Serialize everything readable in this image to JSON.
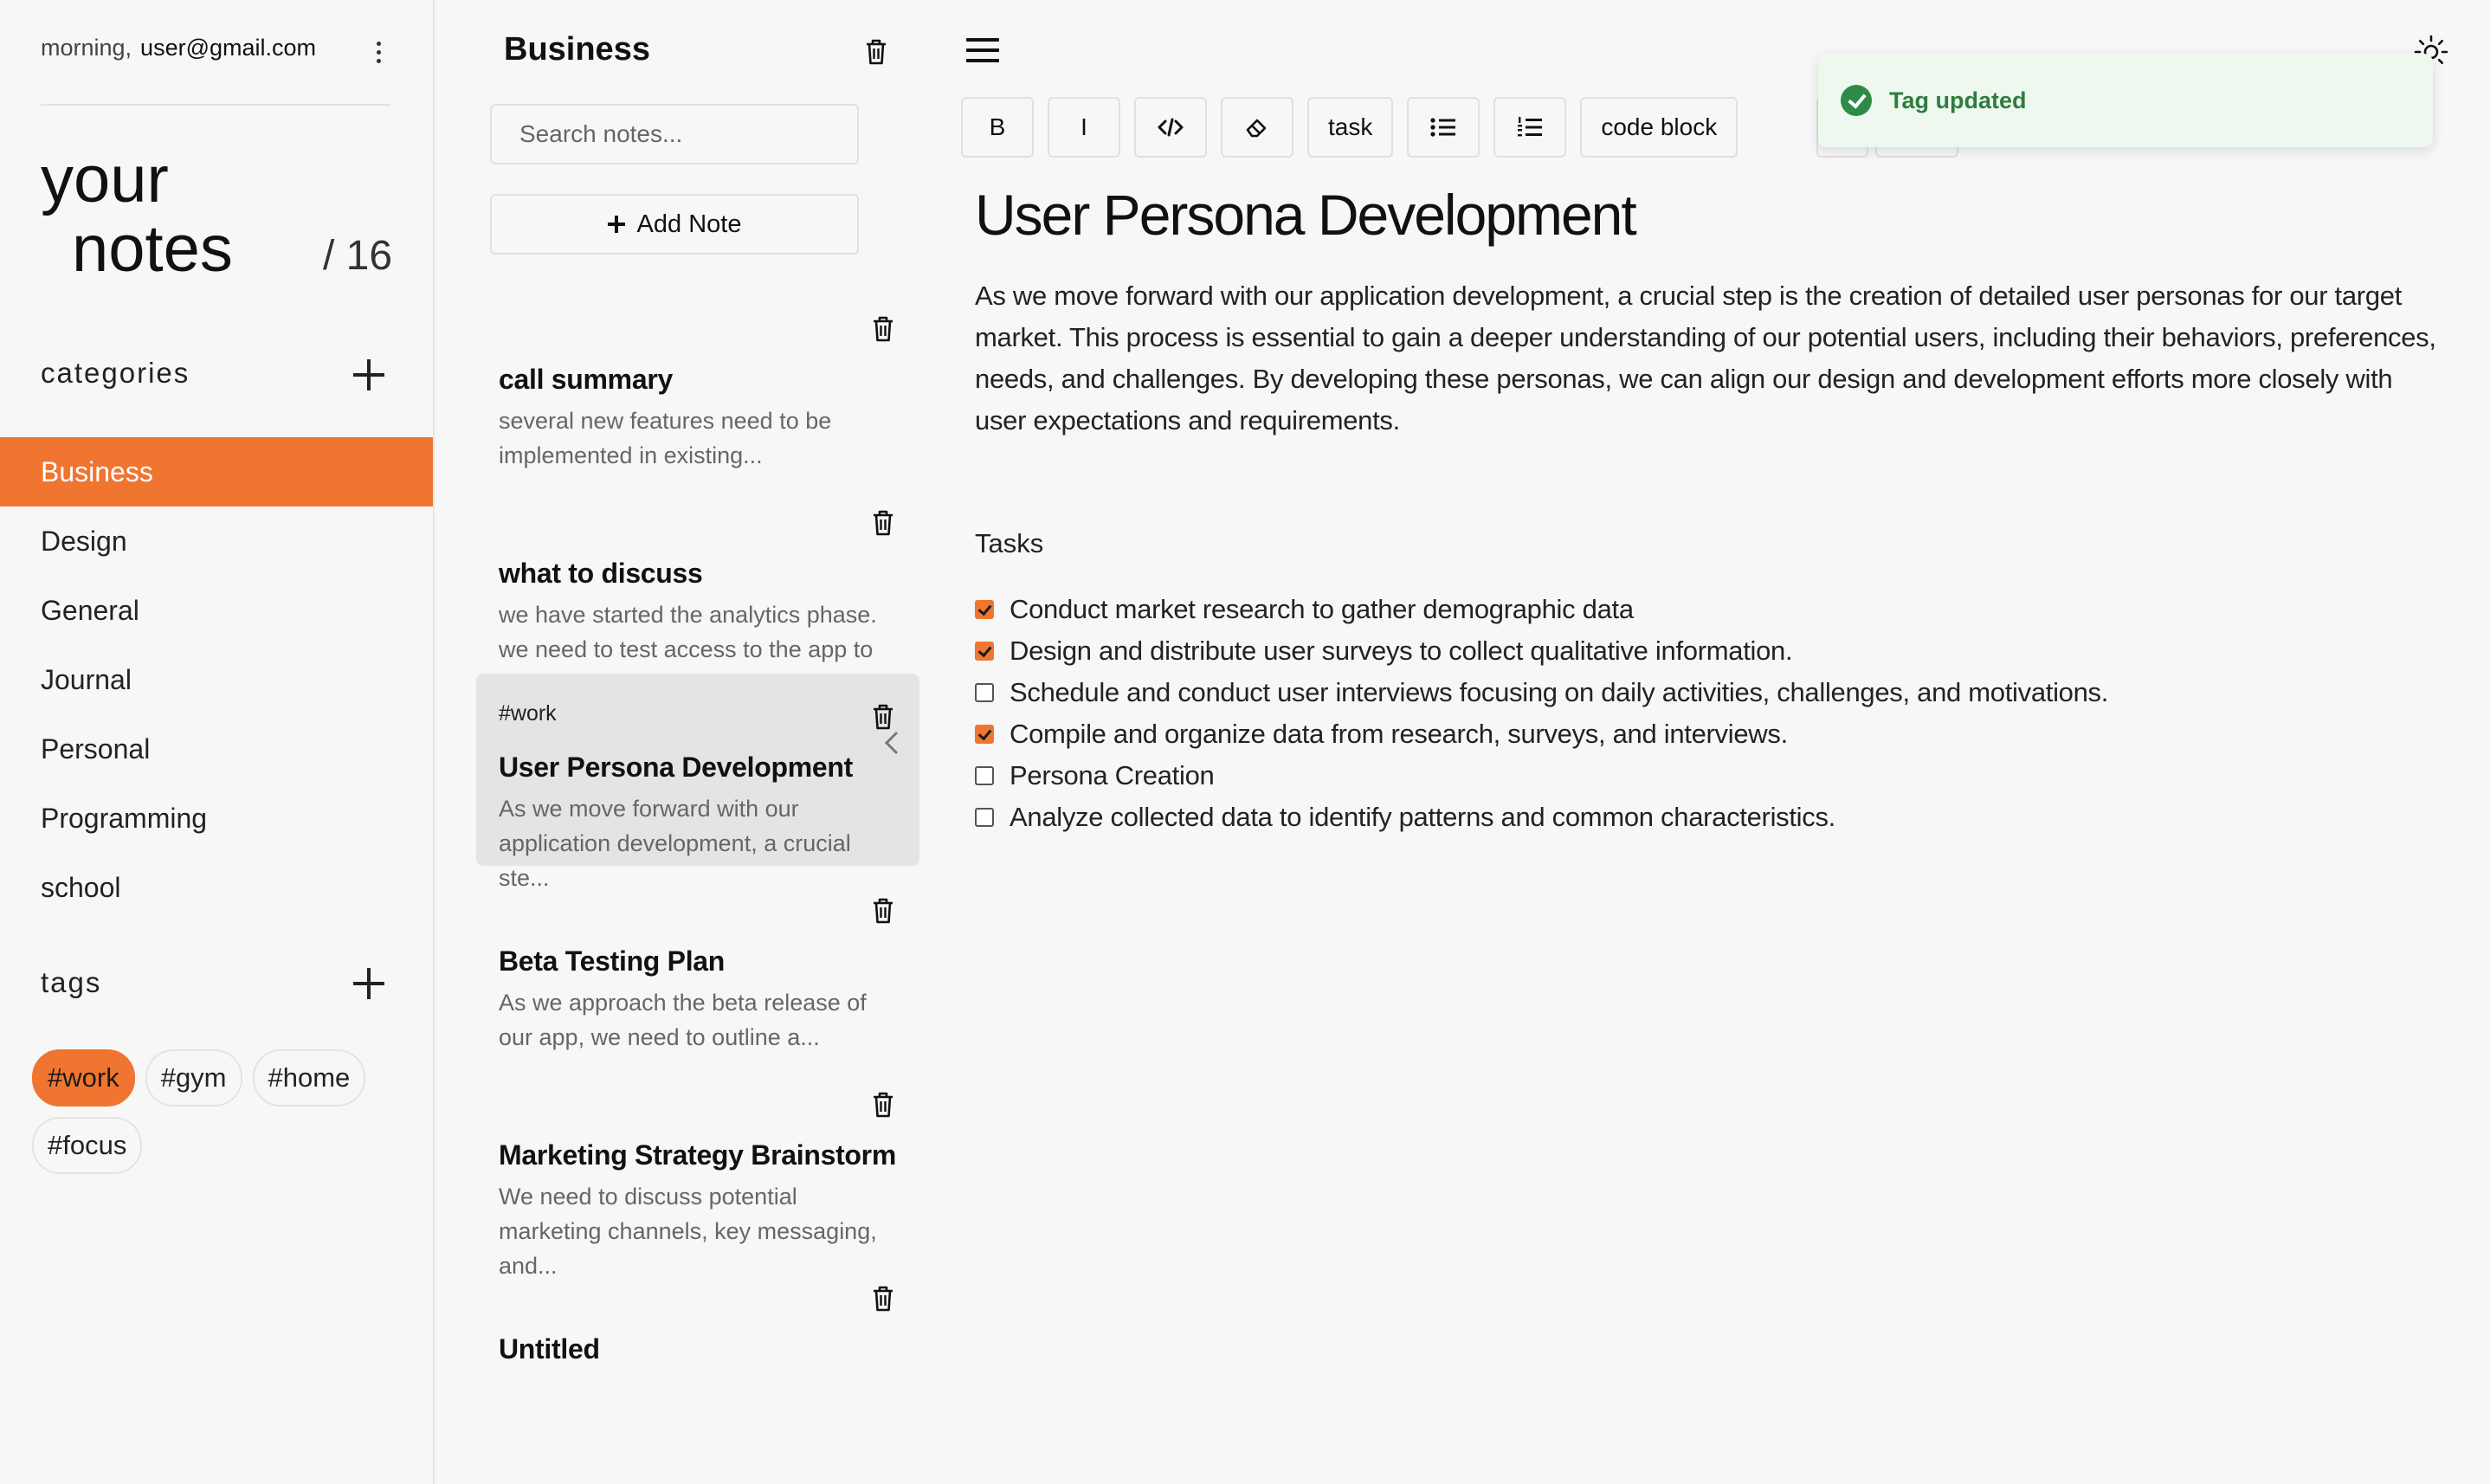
{
  "sidebar": {
    "greeting": "morning,",
    "email": "user@gmail.com",
    "title_line1": "your",
    "title_line2": "notes",
    "count": "/ 16",
    "categories_label": "categories",
    "categories": [
      {
        "label": "Business",
        "active": true
      },
      {
        "label": "Design"
      },
      {
        "label": "General"
      },
      {
        "label": "Journal"
      },
      {
        "label": "Personal"
      },
      {
        "label": "Programming"
      },
      {
        "label": "school"
      }
    ],
    "tags_label": "tags",
    "tags": [
      {
        "label": "#work",
        "active": true
      },
      {
        "label": "#gym"
      },
      {
        "label": "#home"
      },
      {
        "label": "#focus"
      }
    ]
  },
  "notes_list": {
    "title": "Business",
    "search_placeholder": "Search notes...",
    "add_note_label": "Add Note",
    "notes": [
      {
        "tag": "",
        "title": "call summary",
        "preview": "several new features need to be implemented in existing..."
      },
      {
        "tag": "",
        "title": "what to discuss",
        "preview": "we have started the analytics phase. we need to test access to the app to track..."
      },
      {
        "tag": "#work",
        "title": "User Persona Development",
        "preview": "As we move forward with our application development, a crucial ste...",
        "selected": true
      },
      {
        "tag": "",
        "title": "Beta Testing Plan",
        "preview": "As we approach the beta release of our app, we need to outline a..."
      },
      {
        "tag": "",
        "title": "Marketing Strategy Brainstorm",
        "preview": "We need to discuss potential marketing channels, key messaging, and..."
      },
      {
        "tag": "",
        "title": "Untitled",
        "preview": ""
      }
    ]
  },
  "toolbar": {
    "bold": "B",
    "italic": "I",
    "code_icon": "code-icon",
    "eraser_icon": "eraser-icon",
    "task": "task",
    "bullet_icon": "bullet-list-icon",
    "ordered_icon": "ordered-list-icon",
    "code_block": "code block"
  },
  "editor": {
    "title": "User Persona Development",
    "body": "As we move forward with our application development, a crucial step is the creation of detailed user personas for our target market. This process is essential to gain a deeper understanding of our potential users, including their behaviors, preferences, needs, and challenges. By developing these personas, we can align our design and development efforts more closely with user expectations and requirements.",
    "tasks_heading": "Tasks",
    "tasks": [
      {
        "text": "Conduct market research to gather demographic data",
        "checked": true
      },
      {
        "text": "Design and distribute user surveys to collect qualitative information.",
        "checked": true
      },
      {
        "text": "Schedule and conduct user interviews focusing on daily activities, challenges, and motivations.",
        "checked": false
      },
      {
        "text": "Compile and organize data from research, surveys, and interviews.",
        "checked": true
      },
      {
        "text": "Persona Creation",
        "checked": false
      },
      {
        "text": "Analyze collected data to identify patterns and common characteristics.",
        "checked": false
      }
    ]
  },
  "toast": {
    "message": "Tag updated",
    "icon": "check-circle-icon"
  },
  "colors": {
    "accent": "#f07530",
    "toast_bg": "#eef8ee",
    "toast_text": "#2e7d3e",
    "selected_note_bg": "#e4e4e4"
  }
}
